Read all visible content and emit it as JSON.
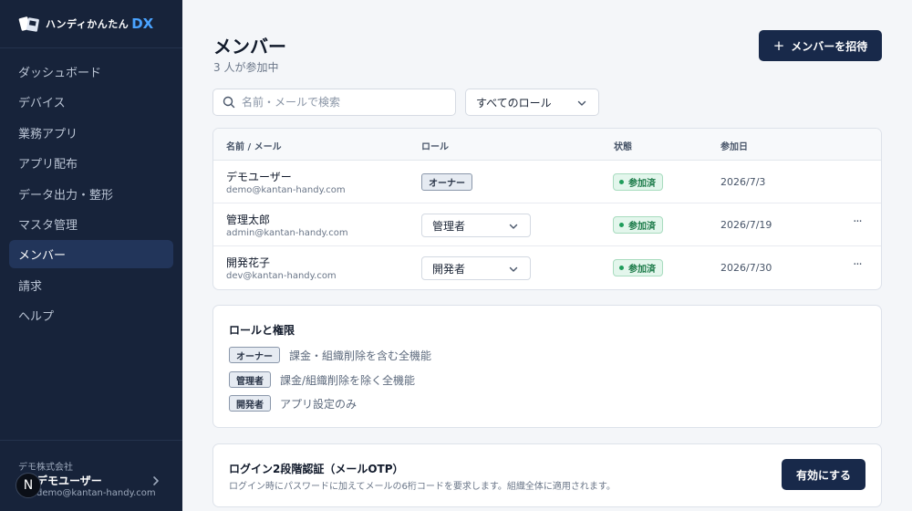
{
  "brand": {
    "name": "ハンディかんたん",
    "suffix": "DX"
  },
  "sidebar": {
    "items": [
      {
        "label": "ダッシュボード"
      },
      {
        "label": "デバイス"
      },
      {
        "label": "業務アプリ"
      },
      {
        "label": "アプリ配布"
      },
      {
        "label": "データ出力・整形"
      },
      {
        "label": "マスタ管理"
      },
      {
        "label": "メンバー",
        "active": true
      },
      {
        "label": "請求"
      },
      {
        "label": "ヘルプ"
      }
    ],
    "footer": {
      "org": "デモ株式会社",
      "user_name": "デモユーザー",
      "user_email": "demo@kantan-handy.com",
      "avatar_letter": "N"
    }
  },
  "header": {
    "title": "メンバー",
    "subtitle": "3 人が参加中",
    "invite_label": "メンバーを招待"
  },
  "filters": {
    "search_placeholder": "名前・メールで検索",
    "role_filter": "すべてのロール"
  },
  "table": {
    "columns": [
      "名前 / メール",
      "ロール",
      "状態",
      "参加日"
    ],
    "rows": [
      {
        "name": "デモユーザー",
        "email": "demo@kantan-handy.com",
        "role": "オーナー",
        "role_editable": false,
        "status": "参加済",
        "joined": "2026/7/3"
      },
      {
        "name": "管理太郎",
        "email": "admin@kantan-handy.com",
        "role": "管理者",
        "role_editable": true,
        "status": "参加済",
        "joined": "2026/7/19"
      },
      {
        "name": "開発花子",
        "email": "dev@kantan-handy.com",
        "role": "開発者",
        "role_editable": true,
        "status": "参加済",
        "joined": "2026/7/30"
      }
    ],
    "more_label": "···"
  },
  "roles": {
    "title": "ロールと権限",
    "items": [
      {
        "tag": "オーナー",
        "desc": "課金・組織削除を含む全機能"
      },
      {
        "tag": "管理者",
        "desc": "課金/組織削除を除く全機能"
      },
      {
        "tag": "開発者",
        "desc": "アプリ設定のみ"
      }
    ]
  },
  "two_factor": {
    "title": "ログイン2段階認証（メールOTP）",
    "description": "ログイン時にパスワードに加えてメールの6桁コードを要求します。組織全体に適用されます。",
    "button_label": "有効にする"
  },
  "colors": {
    "sidebar_bg": "#17233a",
    "primary_button": "#18294a",
    "accent": "#4aa3ff",
    "status_green": "#1b7a48"
  }
}
